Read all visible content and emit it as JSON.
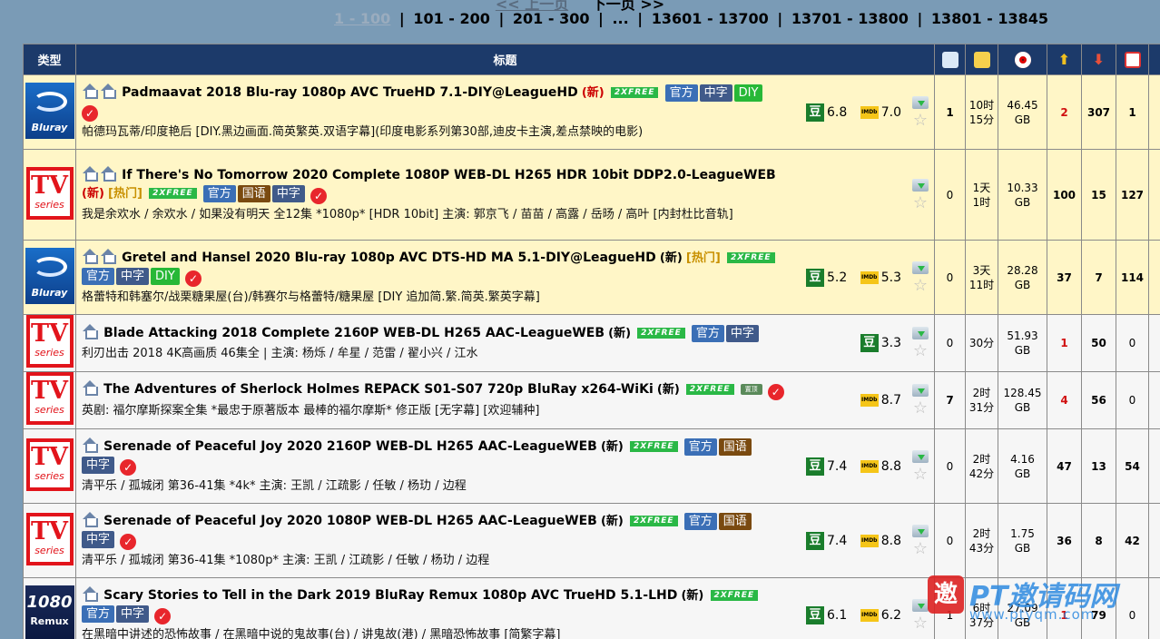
{
  "pager": {
    "prev_label": "<< 上一页",
    "next_label": "下一页 >>",
    "current": "1 - 100",
    "pages": [
      "101 - 200",
      "201 - 300",
      "...",
      "13601 - 13700",
      "13701 - 13800",
      "13801 - 13845"
    ]
  },
  "headers": {
    "type": "类型",
    "title": "标题"
  },
  "rows": [
    {
      "category": "Bluray",
      "name": "Padmaavat 2018 Blu-ray 1080p AVC TrueHD 7.1-DIY@LeagueHD",
      "new": "(新)",
      "free": "2XFREE",
      "tags": [
        "官方",
        "中字",
        "DIY"
      ],
      "sub": "帕德玛瓦蒂/印度艳后 [DIY.黑边画面.简英繁英.双语字幕](印度电影系列第30部,迪皮卡主演,差点禁映的电影)",
      "douban": "6.8",
      "imdb": "7.0",
      "comments": "1",
      "time_a": "10时",
      "time_b": "15分",
      "size_a": "46.45",
      "size_b": "GB",
      "seeders": "2",
      "leechers": "307",
      "completed": "1"
    },
    {
      "category_tv": "TV",
      "category_series": "series",
      "name": "If There's No Tomorrow 2020 Complete 1080P WEB-DL H265 HDR 10bit DDP2.0-LeagueWEB",
      "new": "(新)",
      "hot": "[热门]",
      "free": "2XFREE",
      "tags": [
        "官方",
        "国语",
        "中字"
      ],
      "sub": "我是余欢水 / 余欢水 / 如果没有明天 全12集 *1080p* [HDR 10bit] 主演: 郭京飞 / 苗苗 / 高露 / 岳旸 / 高叶 [内封杜比音轨]",
      "comments": "0",
      "time_a": "1天",
      "time_b": "1时",
      "size_a": "10.33",
      "size_b": "GB",
      "seeders": "100",
      "leechers": "15",
      "completed": "127"
    },
    {
      "category": "Bluray",
      "name": "Gretel and Hansel 2020 Blu-ray 1080p AVC DTS-HD MA 5.1-DIY@LeagueHD",
      "new": "(新)",
      "hot": "[热门]",
      "free": "2XFREE",
      "tags": [
        "官方",
        "中字",
        "DIY"
      ],
      "sub": "格蕾特和韩塞尔/战栗糖果屋(台)/韩赛尔与格蕾特/糖果屋 [DIY 追加简.繁.简英.繁英字幕]",
      "douban": "5.2",
      "imdb": "5.3",
      "comments": "0",
      "time_a": "3天",
      "time_b": "11时",
      "size_a": "28.28",
      "size_b": "GB",
      "seeders": "37",
      "leechers": "7",
      "completed": "114"
    },
    {
      "category_tv": "TV",
      "category_series": "series",
      "name": "Blade Attacking 2018 Complete 2160P WEB-DL H265 AAC-LeagueWEB",
      "new": "(新)",
      "free": "2XFREE",
      "tags": [
        "官方",
        "中字"
      ],
      "sub": "利刃出击 2018 4K高画质 46集全 | 主演: 杨烁 / 牟星 / 范雷 / 翟小兴 / 江水",
      "douban": "3.3",
      "comments": "0",
      "time_a": "30分",
      "size_a": "51.93",
      "size_b": "GB",
      "seeders": "1",
      "leechers": "50",
      "completed": "0"
    },
    {
      "category_tv": "TV",
      "category_series": "series",
      "name": "The Adventures of Sherlock Holmes REPACK S01-S07 720p BluRay x264-WiKi",
      "new": "(新)",
      "free": "2XFREE",
      "top": "置顶",
      "sub": "英剧: 福尔摩斯探案全集 *最忠于原著版本 最棒的福尔摩斯* 修正版 [无字幕] [欢迎辅种]",
      "imdb": "8.7",
      "comments": "7",
      "time_a": "2时",
      "time_b": "31分",
      "size_a": "128.45",
      "size_b": "GB",
      "seeders": "4",
      "leechers": "56",
      "completed": "0"
    },
    {
      "category_tv": "TV",
      "category_series": "series",
      "name": "Serenade of Peaceful Joy 2020 2160P WEB-DL H265 AAC-LeagueWEB",
      "new": "(新)",
      "free": "2XFREE",
      "tags": [
        "官方",
        "国语",
        "中字"
      ],
      "sub": "清平乐 / 孤城闭 第36-41集 *4k* 主演: 王凯 / 江疏影 / 任敏 / 杨玏 / 边程",
      "douban": "7.4",
      "imdb": "8.8",
      "comments": "0",
      "time_a": "2时",
      "time_b": "42分",
      "size_a": "4.16",
      "size_b": "GB",
      "seeders": "47",
      "leechers": "13",
      "completed": "54"
    },
    {
      "category_tv": "TV",
      "category_series": "series",
      "name": "Serenade of Peaceful Joy 2020 1080P WEB-DL H265 AAC-LeagueWEB",
      "new": "(新)",
      "free": "2XFREE",
      "tags": [
        "官方",
        "国语",
        "中字"
      ],
      "sub": "清平乐 / 孤城闭 第36-41集 *1080p* 主演: 王凯 / 江疏影 / 任敏 / 杨玏 / 边程",
      "douban": "7.4",
      "imdb": "8.8",
      "comments": "0",
      "time_a": "2时",
      "time_b": "43分",
      "size_a": "1.75",
      "size_b": "GB",
      "seeders": "36",
      "leechers": "8",
      "completed": "42"
    },
    {
      "category_1080": "1080",
      "category_remux": "Remux",
      "name": "Scary Stories to Tell in the Dark 2019 BluRay Remux 1080p AVC TrueHD 5.1-LHD",
      "new": "(新)",
      "free": "2XFREE",
      "tags": [
        "官方",
        "中字"
      ],
      "sub": "在黑暗中讲述的恐怖故事 / 在黑暗中说的鬼故事(台) / 讲鬼故(港) / 黑暗恐怖故事 [简繁字幕]",
      "douban": "6.1",
      "imdb": "6.2",
      "comments": "1",
      "time_a": "6时",
      "time_b": "37分",
      "size_a": "27.09",
      "size_b": "GB",
      "seeders": "1",
      "leechers": "79",
      "completed": "0"
    }
  ],
  "labels": {
    "douban": "豆",
    "imdb": "IMDb",
    "check": "✓",
    "star": "☆"
  },
  "watermark": {
    "logo": "邀",
    "title": "PT邀请码网",
    "url": "www.ptyqm.com"
  }
}
